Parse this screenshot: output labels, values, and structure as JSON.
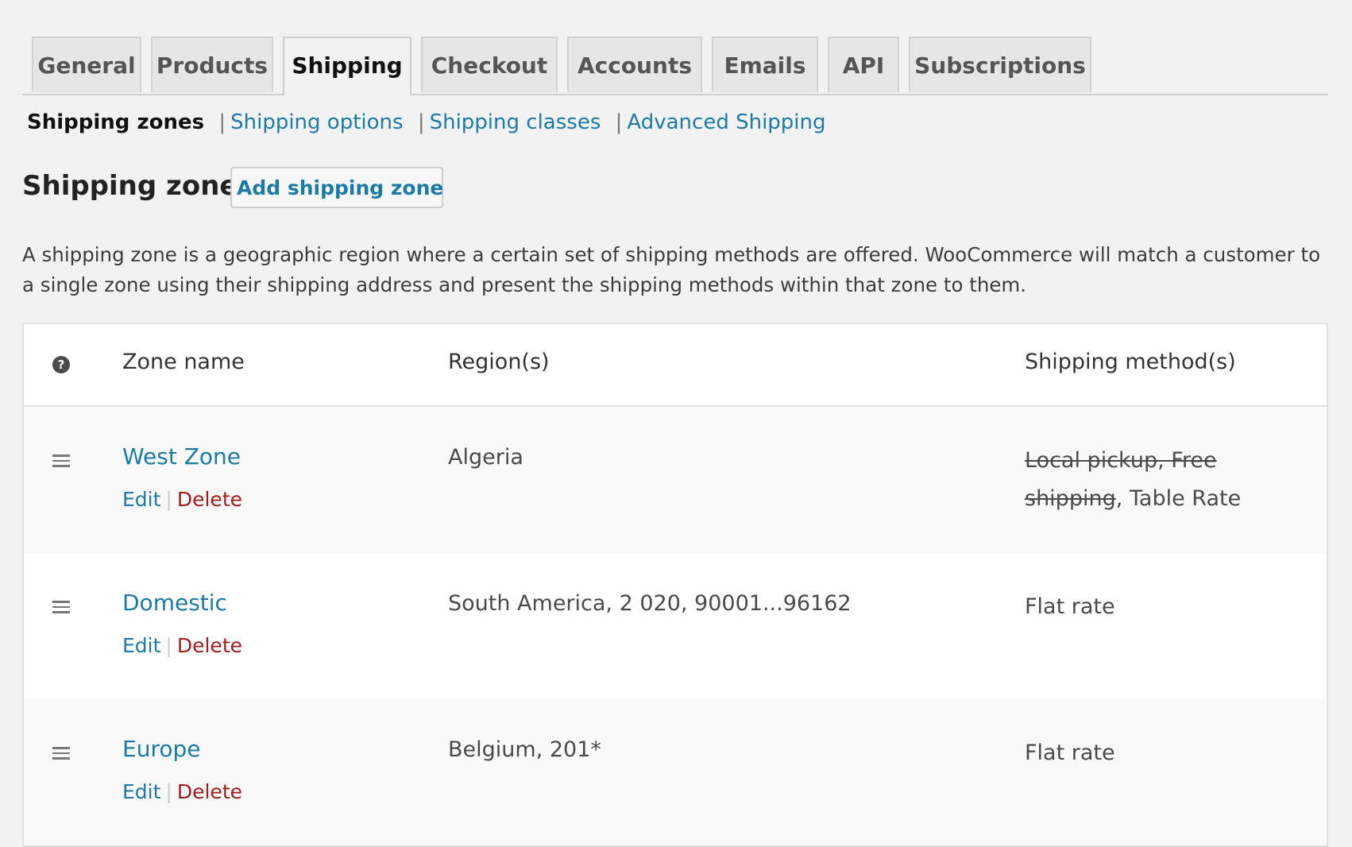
{
  "tabs": [
    {
      "label": "General",
      "active": false
    },
    {
      "label": "Products",
      "active": false
    },
    {
      "label": "Shipping",
      "active": true
    },
    {
      "label": "Checkout",
      "active": false
    },
    {
      "label": "Accounts",
      "active": false
    },
    {
      "label": "Emails",
      "active": false
    },
    {
      "label": "API",
      "active": false
    },
    {
      "label": "Subscriptions",
      "active": false
    }
  ],
  "subnav": {
    "current": "Shipping zones",
    "links": [
      "Shipping options",
      "Shipping classes",
      "Advanced Shipping"
    ],
    "separator": "|"
  },
  "heading": {
    "title": "Shipping zones",
    "add_button": "Add shipping zone"
  },
  "description": "A shipping zone is a geographic region where a certain set of shipping methods are offered. WooCommerce will match a customer to a single zone using their shipping address and present the shipping methods within that zone to them.",
  "table": {
    "help_glyph": "?",
    "headers": {
      "zone_name": "Zone name",
      "regions": "Region(s)",
      "methods": "Shipping method(s)"
    },
    "action_labels": {
      "edit": "Edit",
      "delete": "Delete",
      "separator": "|"
    },
    "rows": [
      {
        "name": "West Zone",
        "region": "Algeria",
        "methods_disabled": "Local pickup, Free shipping",
        "methods_separator": ", ",
        "methods_enabled": "Table Rate"
      },
      {
        "name": "Domestic",
        "region": "South America, 2 020, 90001...96162",
        "methods_disabled": "",
        "methods_separator": "",
        "methods_enabled": "Flat rate"
      },
      {
        "name": "Europe",
        "region": "Belgium, 201*",
        "methods_disabled": "",
        "methods_separator": "",
        "methods_enabled": "Flat rate"
      }
    ]
  },
  "colors": {
    "link": "#1b7ba6",
    "delete": "#a01d1d",
    "background": "#f2f2f2"
  }
}
